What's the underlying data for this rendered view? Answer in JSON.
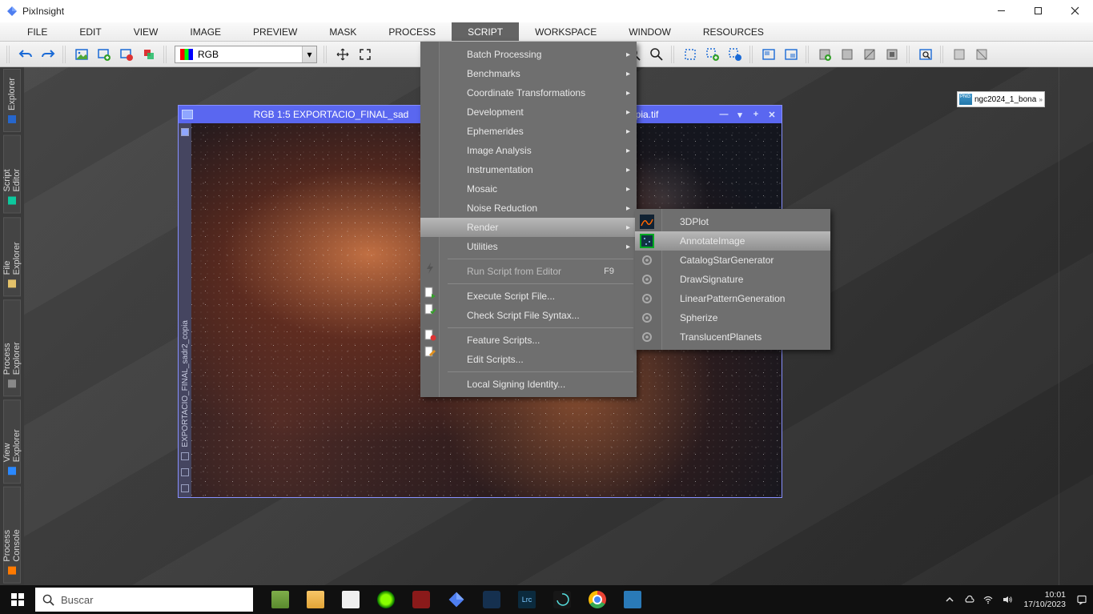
{
  "app_title": "PixInsight",
  "menubar": [
    "FILE",
    "EDIT",
    "VIEW",
    "IMAGE",
    "PREVIEW",
    "MASK",
    "PROCESS",
    "SCRIPT",
    "WORKSPACE",
    "WINDOW",
    "RESOURCES"
  ],
  "active_menu": "SCRIPT",
  "channel_combo": "RGB",
  "leftdock_tabs": [
    {
      "label": "Process Console",
      "color": "orange"
    },
    {
      "label": "View Explorer",
      "color": "cyan"
    },
    {
      "label": "Process Explorer",
      "color": "gear"
    },
    {
      "label": "File Explorer",
      "color": "manila"
    },
    {
      "label": "Script Editor",
      "color": "teal"
    },
    {
      "label": "Explorer",
      "color": "blue"
    }
  ],
  "image_window": {
    "title": "RGB 1:5 EXPORTACIO_FINAL_sadr2_copia | EXPORTACIO_FINAL_sadr2_copia.tif",
    "title_visible_left": "RGB 1:5 EXPORTACIO_FINAL_sad",
    "title_visible_right": "opia.tif",
    "sidebar_text": "EXPORTACIO_FINAL_sadr2_copia"
  },
  "script_menu": {
    "groups_with_sub": [
      "Batch Processing",
      "Benchmarks",
      "Coordinate Transformations",
      "Development",
      "Ephemerides",
      "Image Analysis",
      "Instrumentation",
      "Mosaic",
      "Noise Reduction",
      "Render",
      "Utilities"
    ],
    "highlighted": "Render",
    "run_from_editor": {
      "label": "Run Script from Editor",
      "shortcut": "F9",
      "enabled": false
    },
    "items_after_sep1": [
      "Execute Script File...",
      "Check Script File Syntax..."
    ],
    "items_after_sep2": [
      "Feature Scripts...",
      "Edit Scripts..."
    ],
    "items_after_sep3": [
      "Local Signing Identity..."
    ]
  },
  "render_submenu": {
    "items": [
      "3DPlot",
      "AnnotateImage",
      "CatalogStarGenerator",
      "DrawSignature",
      "LinearPatternGeneration",
      "Spherize",
      "TranslucentPlanets"
    ],
    "highlighted": "AnnotateImage"
  },
  "thumbnail_label": "ngc2024_1_bona",
  "taskbar": {
    "search_placeholder": "Buscar",
    "clock_time": "10:01",
    "clock_date": "17/10/2023"
  }
}
